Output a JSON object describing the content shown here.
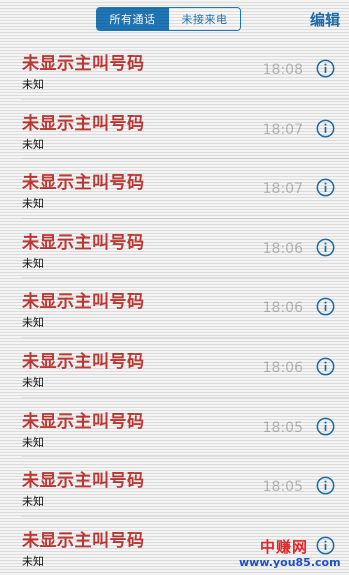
{
  "header": {
    "tabs": [
      {
        "label": "所有通话",
        "active": true
      },
      {
        "label": "未接来电",
        "active": false
      }
    ],
    "edit_label": "编辑"
  },
  "calls": [
    {
      "caller": "未显示主叫号码",
      "subtitle": "未知",
      "time": "18:08"
    },
    {
      "caller": "未显示主叫号码",
      "subtitle": "未知",
      "time": "18:07"
    },
    {
      "caller": "未显示主叫号码",
      "subtitle": "未知",
      "time": "18:07"
    },
    {
      "caller": "未显示主叫号码",
      "subtitle": "未知",
      "time": "18:06"
    },
    {
      "caller": "未显示主叫号码",
      "subtitle": "未知",
      "time": "18:06"
    },
    {
      "caller": "未显示主叫号码",
      "subtitle": "未知",
      "time": "18:06"
    },
    {
      "caller": "未显示主叫号码",
      "subtitle": "未知",
      "time": "18:05"
    },
    {
      "caller": "未显示主叫号码",
      "subtitle": "未知",
      "time": "18:05"
    },
    {
      "caller": "未显示主叫号码",
      "subtitle": "未知",
      "time": ""
    }
  ],
  "watermark": {
    "title": "中赚网",
    "url": "www.you85.com"
  },
  "colors": {
    "accent": "#1f77b7",
    "missed_call_red": "#c03a36",
    "time_gray": "#b8b8b8"
  },
  "icons": {
    "info": "info-circle-icon"
  }
}
